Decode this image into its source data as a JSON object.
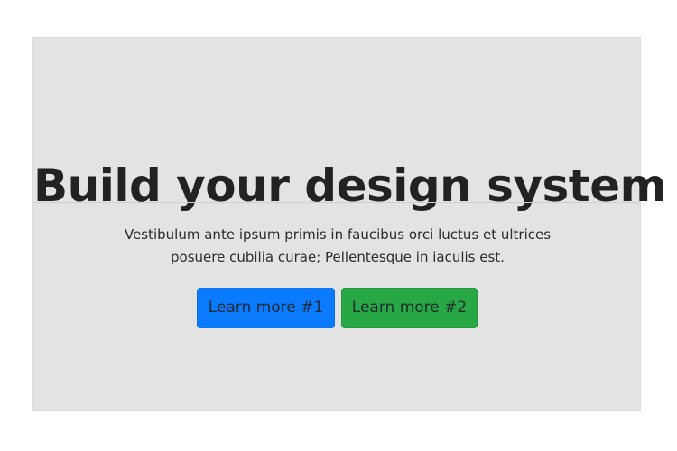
{
  "hero": {
    "title": "Build your design system",
    "lead": "Vestibulum ante ipsum primis in faucibus orci luctus et ultrices posuere cubilia curae; Pellentesque in iaculis est.",
    "buttons": [
      {
        "label": "Learn more #1",
        "color": "#0a7bff"
      },
      {
        "label": "Learn more #2",
        "color": "#28a745"
      }
    ]
  },
  "colors": {
    "hero_background": "#e3e3e3",
    "title_text": "#222222"
  }
}
